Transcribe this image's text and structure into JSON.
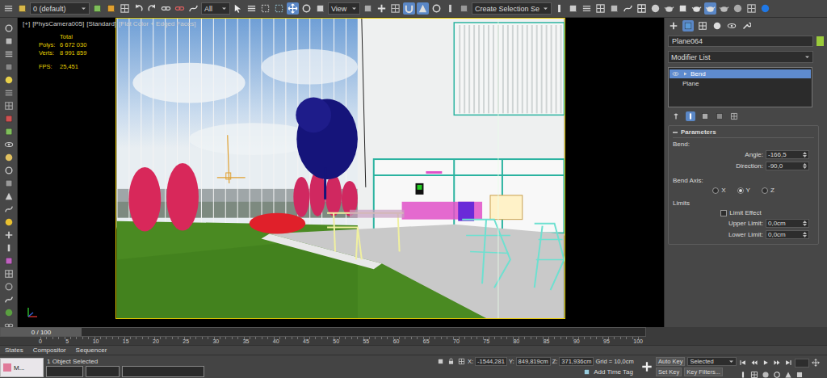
{
  "toolbar": {
    "layer": "0 (default)",
    "filter": "All",
    "coordinate_system": "View",
    "selection_set": "Create Selection Se"
  },
  "viewport": {
    "labels": [
      "[+]",
      "[PhysCamera005]",
      "[Standard]",
      "[Flat Color + Edged Faces]"
    ],
    "stats": {
      "title": "Total",
      "rows": [
        {
          "label": "Polys:",
          "value": "6 672 030"
        },
        {
          "label": "Verts:",
          "value": "8 991 859"
        },
        {
          "label": "FPS:",
          "value": "25,451"
        }
      ]
    }
  },
  "command_panel": {
    "object_name": "Plane064",
    "object_color": "#9bcb3b",
    "modifier_list": "Modifier List",
    "stack": [
      {
        "label": "Bend",
        "selected": true
      },
      {
        "label": "Plane",
        "selected": false
      }
    ],
    "rollout": {
      "title": "Parameters",
      "bend_label": "Bend:",
      "fields": [
        {
          "label": "Angle:",
          "value": "-166,5"
        },
        {
          "label": "Direction:",
          "value": "-90,0"
        }
      ],
      "axis_label": "Bend Axis:",
      "axes": [
        {
          "label": "X",
          "selected": false
        },
        {
          "label": "Y",
          "selected": true
        },
        {
          "label": "Z",
          "selected": false
        }
      ],
      "limits_label": "Limits",
      "limit_effect": {
        "label": "Limit Effect",
        "checked": false
      },
      "limit_fields": [
        {
          "label": "Upper Limit:",
          "value": "0,0cm"
        },
        {
          "label": "Lower Limit:",
          "value": "0,0cm"
        }
      ]
    }
  },
  "timeline": {
    "frame": "0 / 100",
    "level": 0,
    "ticks": [
      "0",
      "5",
      "10",
      "15",
      "20",
      "25",
      "30",
      "35",
      "40",
      "45",
      "50",
      "55",
      "60",
      "65",
      "70",
      "75",
      "80",
      "85",
      "90",
      "95",
      "100"
    ]
  },
  "tabs": [
    {
      "label": "States"
    },
    {
      "label": "Compositor"
    },
    {
      "label": "Sequencer"
    }
  ],
  "status_bar": {
    "taskbar": "M...",
    "selection": "1 Object Selected",
    "coordinates": [
      {
        "label": "X:",
        "value": "-1544,281"
      },
      {
        "label": "Y:",
        "value": "849,819cm"
      },
      {
        "label": "Z:",
        "value": "371,936cm"
      }
    ],
    "grid": "Grid = 10,0cm",
    "time_tag": "Add Time Tag"
  },
  "animation": {
    "auto_key": "Auto Key",
    "key_mode": "Selected",
    "set_key": "Set Key",
    "key_filters": "Key Filters..."
  }
}
